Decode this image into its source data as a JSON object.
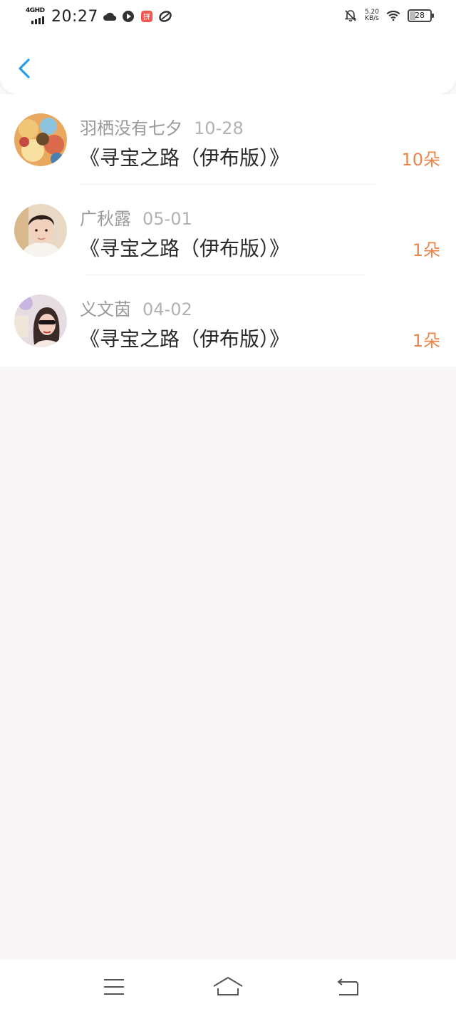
{
  "status_bar": {
    "network": "4GHD",
    "time": "20:27",
    "speed_value": "5.20",
    "speed_unit": "KB/s",
    "battery": "28",
    "icons": [
      "cloud-icon",
      "music-icon",
      "app-badge-icon",
      "link-icon",
      "bell-off-icon",
      "wifi-icon",
      "battery-icon"
    ]
  },
  "header": {
    "back_icon": "back-chevron-icon",
    "accent_color": "#2a9ee6"
  },
  "gifts": [
    {
      "user": "羽栖没有七夕",
      "date": "10-28",
      "title": "《寻宝之路（伊布版）》",
      "count": "10朵"
    },
    {
      "user": "广秋露",
      "date": "05-01",
      "title": "《寻宝之路（伊布版）》",
      "count": "1朵"
    },
    {
      "user": "义文茵",
      "date": "04-02",
      "title": "《寻宝之路（伊布版）》",
      "count": "1朵"
    }
  ],
  "colors": {
    "count": "#e9874a",
    "name": "#9a9a9a",
    "background": "#f8f6f7"
  },
  "nav_bar": {
    "icons": [
      "menu-icon",
      "home-icon",
      "back-icon"
    ]
  }
}
